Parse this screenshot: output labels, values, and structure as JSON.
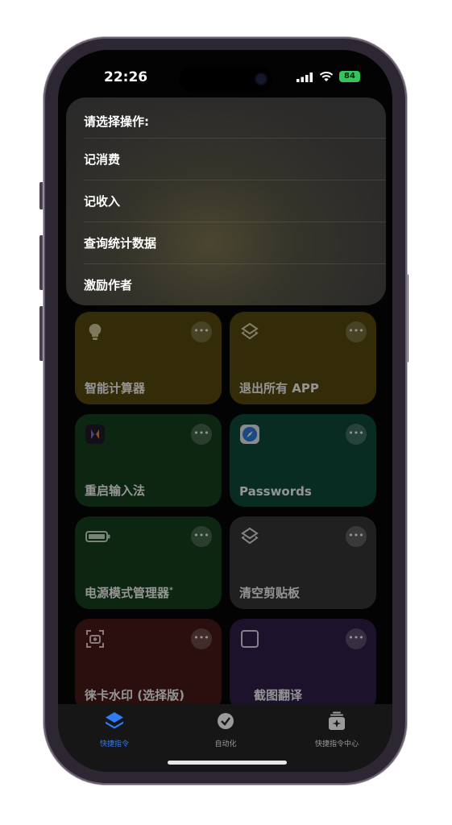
{
  "status_bar": {
    "time": "22:26",
    "battery": "84"
  },
  "action_sheet": {
    "title": "请选择操作:",
    "items": [
      "记消费",
      "记收入",
      "查询统计数据",
      "激励作者"
    ]
  },
  "shortcuts": [
    {
      "label": "智能计算器",
      "icon": "lightbulb-icon",
      "color": "#5a4d0e"
    },
    {
      "label": "退出所有 APP",
      "icon": "layers-icon",
      "color": "#5a4d0e"
    },
    {
      "label": "重启输入法",
      "icon": "app-icon",
      "color": "#17431e"
    },
    {
      "label": "Passwords",
      "icon": "safari-icon",
      "color": "#0f4b3b"
    },
    {
      "label": "电源模式管理器",
      "icon": "battery-icon",
      "color": "#17431e",
      "badge": "*"
    },
    {
      "label": "清空剪贴板",
      "icon": "layers-icon",
      "color": "#383838"
    },
    {
      "label": "徕卡水印 (选择版)",
      "icon": "camera-scan-icon",
      "color": "#4a1b1b"
    },
    {
      "label": "截图翻译",
      "icon": "square-icon",
      "color": "#321f4c"
    }
  ],
  "tab_bar": {
    "tabs": [
      {
        "label": "快捷指令",
        "icon": "layers-icon",
        "active": true
      },
      {
        "label": "自动化",
        "icon": "clock-check-icon",
        "active": false
      },
      {
        "label": "快捷指令中心",
        "icon": "gallery-icon",
        "active": false
      }
    ],
    "accent": "#2f7cf6"
  }
}
